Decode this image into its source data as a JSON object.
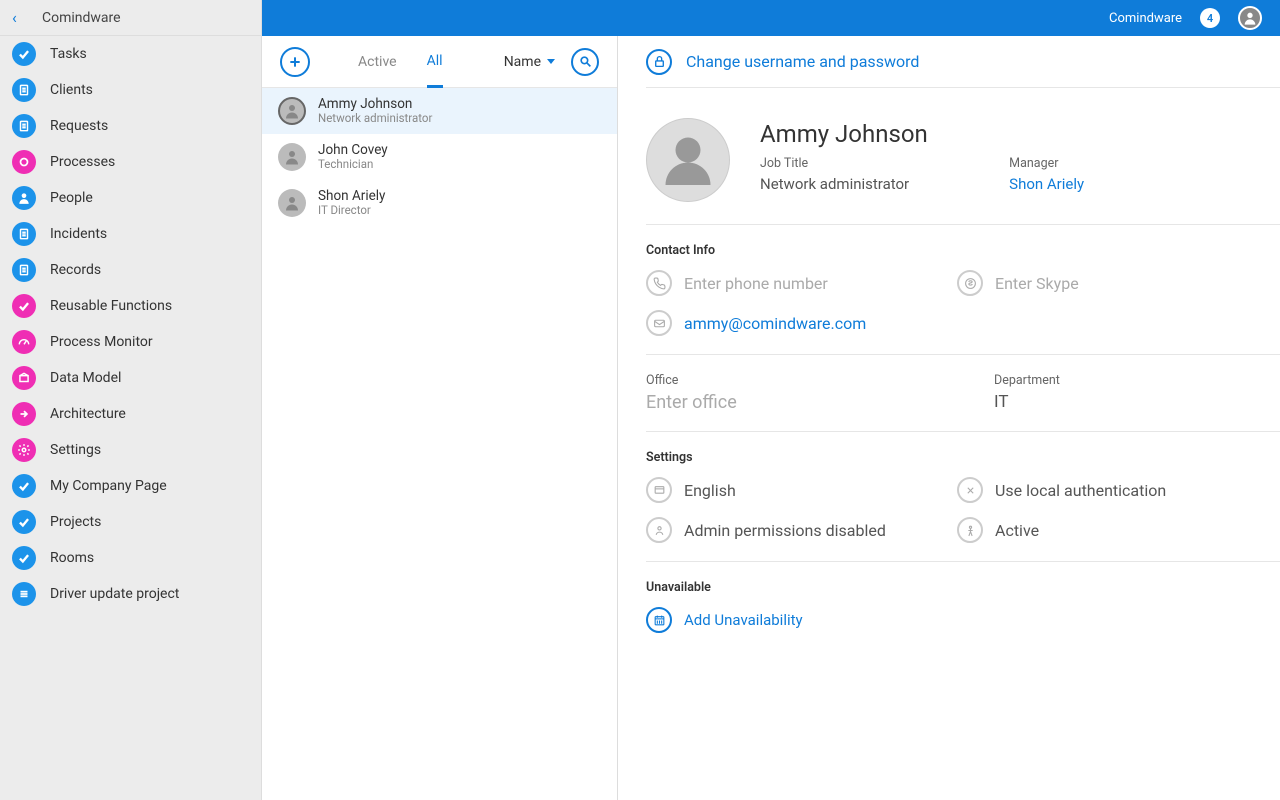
{
  "sidebar": {
    "header": "Comindware",
    "items": [
      {
        "label": "Tasks",
        "icon": "check",
        "color": "blue"
      },
      {
        "label": "Clients",
        "icon": "doc",
        "color": "blue"
      },
      {
        "label": "Requests",
        "icon": "doc",
        "color": "blue"
      },
      {
        "label": "Processes",
        "icon": "circle",
        "color": "pink"
      },
      {
        "label": "People",
        "icon": "person",
        "color": "blue"
      },
      {
        "label": "Incidents",
        "icon": "doc",
        "color": "blue"
      },
      {
        "label": "Records",
        "icon": "doc",
        "color": "blue"
      },
      {
        "label": "Reusable Functions",
        "icon": "check",
        "color": "pink"
      },
      {
        "label": "Process Monitor",
        "icon": "gauge",
        "color": "pink"
      },
      {
        "label": "Data Model",
        "icon": "box",
        "color": "pink"
      },
      {
        "label": "Architecture",
        "icon": "arrow",
        "color": "pink"
      },
      {
        "label": "Settings",
        "icon": "gear",
        "color": "pink"
      },
      {
        "label": "My Company Page",
        "icon": "check",
        "color": "blue"
      },
      {
        "label": "Projects",
        "icon": "check",
        "color": "blue"
      },
      {
        "label": "Rooms",
        "icon": "check",
        "color": "blue"
      },
      {
        "label": "Driver update project",
        "icon": "lines",
        "color": "blue"
      }
    ]
  },
  "topbar": {
    "brand": "Comindware",
    "badge": "4"
  },
  "list": {
    "tabs": {
      "active": "Active",
      "all": "All"
    },
    "sort": "Name",
    "people": [
      {
        "name": "Ammy Johnson",
        "role": "Network administrator",
        "selected": true
      },
      {
        "name": "John Covey",
        "role": "Technician",
        "selected": false
      },
      {
        "name": "Shon Ariely",
        "role": "IT Director",
        "selected": false
      }
    ]
  },
  "detail": {
    "changeCreds": "Change username and password",
    "name": "Ammy Johnson",
    "jobTitleLabel": "Job Title",
    "jobTitle": "Network administrator",
    "managerLabel": "Manager",
    "manager": "Shon Ariely",
    "contactLabel": "Contact Info",
    "phonePlaceholder": "Enter phone number",
    "skypePlaceholder": "Enter Skype",
    "email": "ammy@comindware.com",
    "officeLabel": "Office",
    "officePlaceholder": "Enter office",
    "departmentLabel": "Department",
    "department": "IT",
    "settingsLabel": "Settings",
    "language": "English",
    "auth": "Use local authentication",
    "admin": "Admin permissions disabled",
    "status": "Active",
    "unavailLabel": "Unavailable",
    "addUnavail": "Add Unavailability"
  }
}
